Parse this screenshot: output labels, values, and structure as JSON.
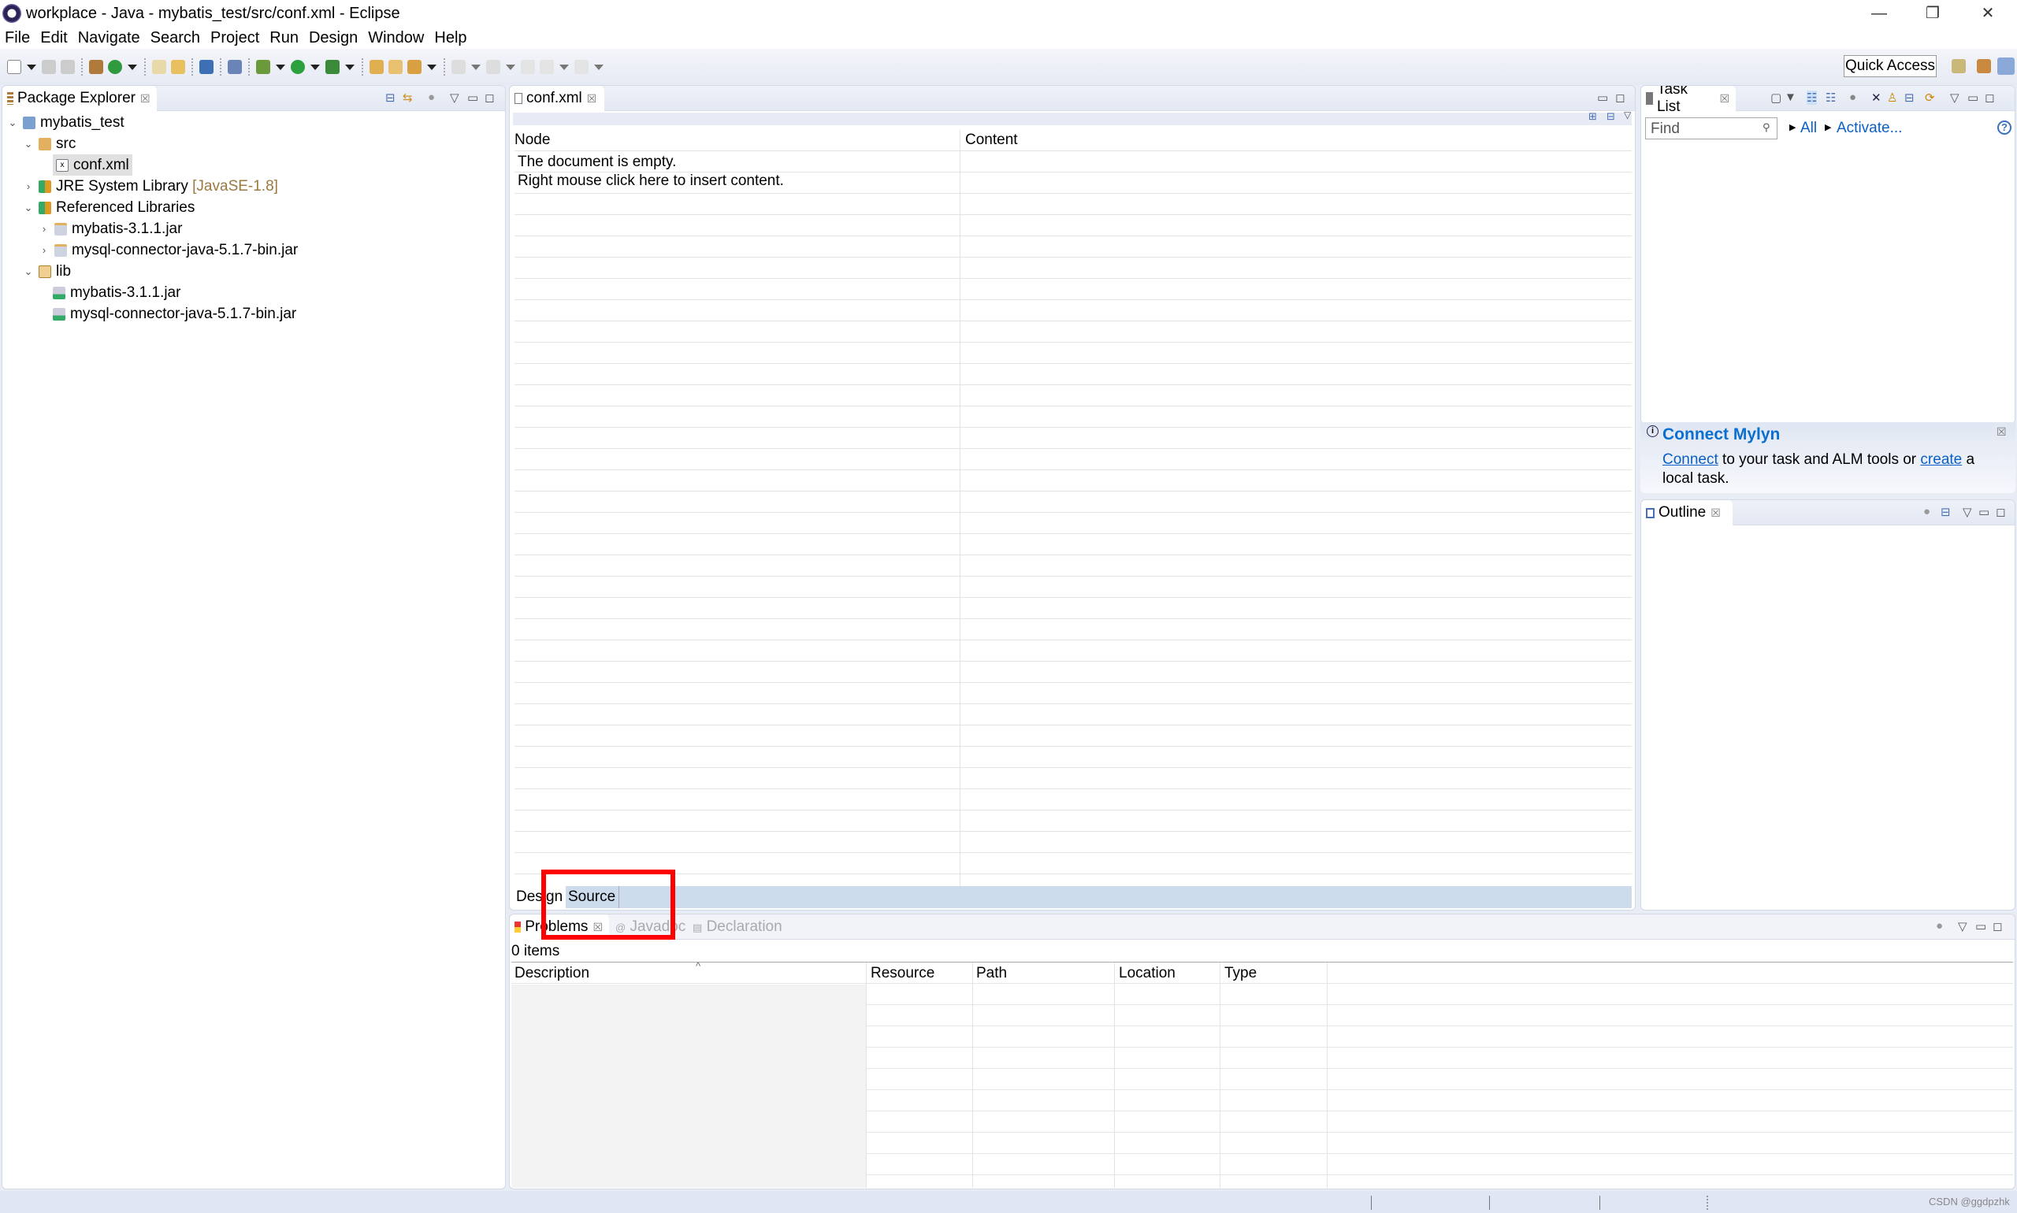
{
  "window": {
    "title": "workplace - Java - mybatis_test/src/conf.xml - Eclipse",
    "minimize": "—",
    "restore": "❐",
    "close": "✕"
  },
  "menu": [
    "File",
    "Edit",
    "Navigate",
    "Search",
    "Project",
    "Run",
    "Design",
    "Window",
    "Help"
  ],
  "toolbar": {
    "quick_access": "Quick Access"
  },
  "package_explorer": {
    "title": "Package Explorer",
    "tree": [
      {
        "label": "mybatis_test",
        "suffix": ""
      },
      {
        "label": "src",
        "suffix": ""
      },
      {
        "label": "conf.xml",
        "suffix": ""
      },
      {
        "label": "JRE System Library",
        "suffix": "[JavaSE-1.8]"
      },
      {
        "label": "Referenced Libraries",
        "suffix": ""
      },
      {
        "label": "mybatis-3.1.1.jar",
        "suffix": ""
      },
      {
        "label": "mysql-connector-java-5.1.7-bin.jar",
        "suffix": ""
      },
      {
        "label": "lib",
        "suffix": ""
      },
      {
        "label": "mybatis-3.1.1.jar",
        "suffix": ""
      },
      {
        "label": "mysql-connector-java-5.1.7-bin.jar",
        "suffix": ""
      }
    ]
  },
  "editor": {
    "tab": "conf.xml",
    "columns": [
      "Node",
      "Content"
    ],
    "empty_lines": [
      "The document is empty.",
      "Right mouse click here to insert content."
    ],
    "bottom_tabs": [
      "Design",
      "Source"
    ]
  },
  "task_list": {
    "title": "Task List",
    "find_placeholder": "Find",
    "all": "All",
    "activate": "Activate...",
    "help": "?"
  },
  "mylyn": {
    "title": "Connect Mylyn",
    "connect": "Connect",
    "text1": " to your task and ALM tools or ",
    "create": "create",
    "text2": " a local task."
  },
  "outline": {
    "title": "Outline"
  },
  "problems": {
    "tabs": [
      "Problems",
      "Javadoc",
      "Declaration"
    ],
    "count": "0 items",
    "columns": [
      "Description",
      "Resource",
      "Path",
      "Location",
      "Type"
    ],
    "sort_indicator": "^"
  },
  "status": {
    "watermark": "CSDN @ggdpzhk"
  },
  "colors": {
    "accent": "#0b5fc4",
    "highlight_box": "#ff0000",
    "selection": "#e0e0e0"
  }
}
